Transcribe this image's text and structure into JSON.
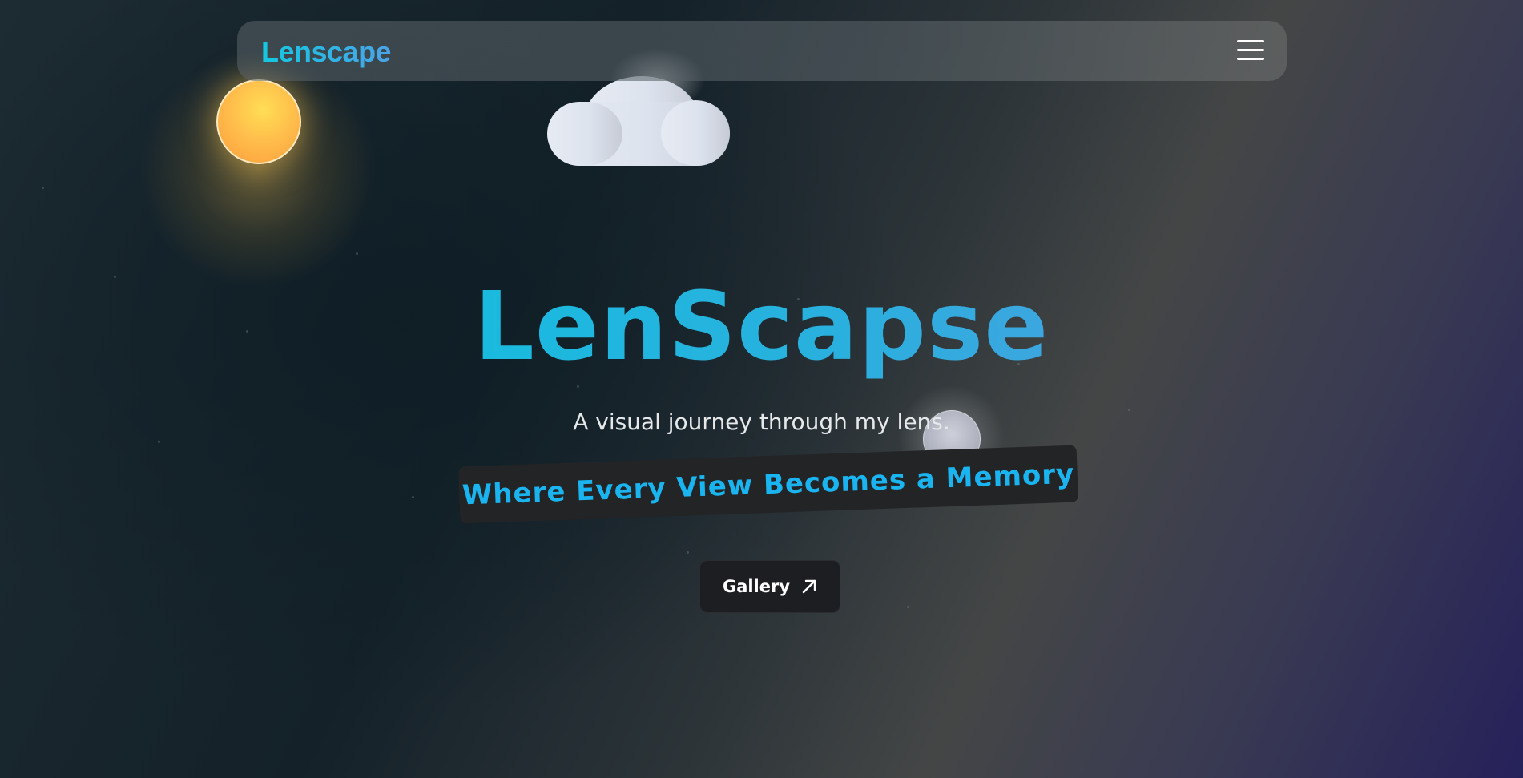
{
  "navbar": {
    "brand": "Lenscape",
    "menu_icon": "hamburger-menu-icon"
  },
  "decorations": {
    "sun_icon": "sun-icon",
    "cloud_icon": "cloud-icon",
    "moon_icon": "moon-icon"
  },
  "hero": {
    "title": "LenScapse",
    "tagline": "A visual journey through my lens.",
    "ribbon": "Where Every View Becomes a Memory"
  },
  "cta": {
    "gallery_label": "Gallery",
    "gallery_icon": "arrow-up-right-icon"
  },
  "colors": {
    "accent": "#1fb7db",
    "ribbon_text": "#1ab4f0",
    "sun": "#ffbb4a",
    "button_bg": "#1d1e22"
  }
}
